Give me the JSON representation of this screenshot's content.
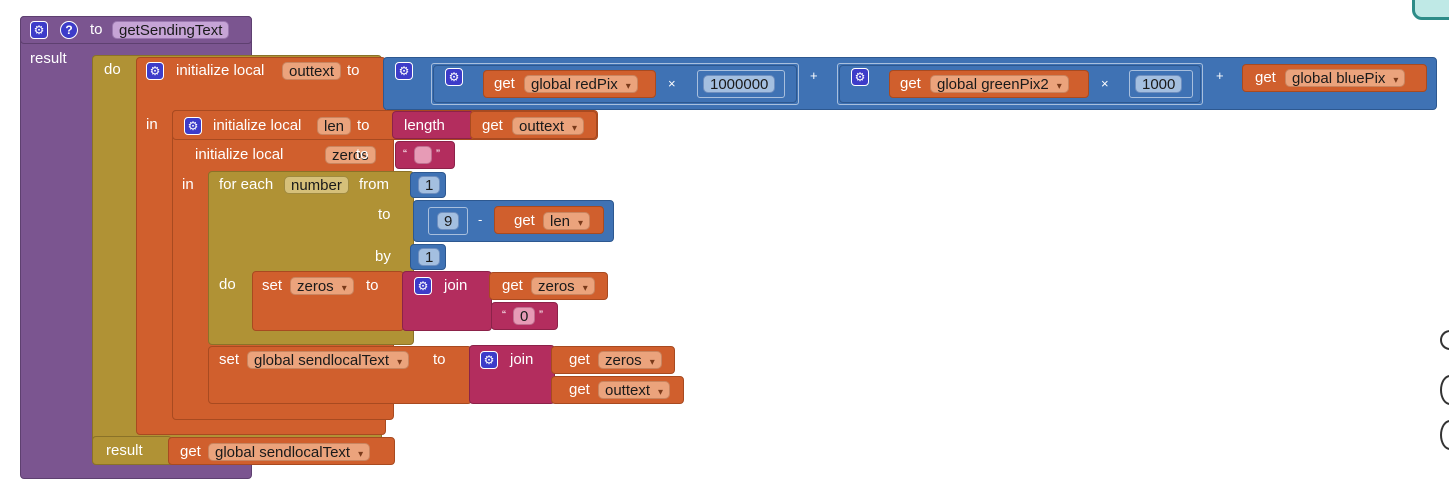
{
  "procedure": {
    "to_label": "to",
    "name": "getSendingText",
    "result_label": "result",
    "do_label": "do",
    "result_label_bottom": "result"
  },
  "outer_local": {
    "label": "initialize local",
    "var": "outtext",
    "to": "to",
    "in": "in"
  },
  "expression": {
    "get": "get",
    "red_var": "global redPix",
    "times": "×",
    "red_mult": "1000000",
    "plus": "+",
    "green_var": "global greenPix2",
    "green_mult": "1000",
    "blue_var": "global bluePix"
  },
  "inner_local": {
    "label1": "initialize local",
    "var1": "len",
    "to1": "to",
    "length": "length",
    "get": "get",
    "length_arg": "outtext",
    "label2": "initialize local",
    "var2": "zeros",
    "to2": "to",
    "empty_open": "“",
    "empty_close": "”",
    "in": "in"
  },
  "for_each": {
    "label": "for each",
    "var": "number",
    "from": "from",
    "from_val": "1",
    "to": "to",
    "to_num": "9",
    "minus": "-",
    "get": "get",
    "to_var": "len",
    "by": "by",
    "by_val": "1",
    "do": "do"
  },
  "set_zeros": {
    "set": "set",
    "var": "zeros",
    "to": "to",
    "join": "join",
    "get": "get",
    "arg1": "zeros",
    "open": "“",
    "arg2": "0",
    "close": "”"
  },
  "set_global": {
    "set": "set",
    "var": "global sendlocalText",
    "to": "to",
    "join": "join",
    "get1": "get",
    "arg1": "zeros",
    "get2": "get",
    "arg2": "outtext"
  },
  "final_result": {
    "get": "get",
    "var": "global sendlocalText"
  },
  "colors": {
    "procedure": "#7b5590",
    "control": "#b09235",
    "variables": "#d05f2d",
    "math": "#3f72b4",
    "text": "#b32d5e"
  }
}
